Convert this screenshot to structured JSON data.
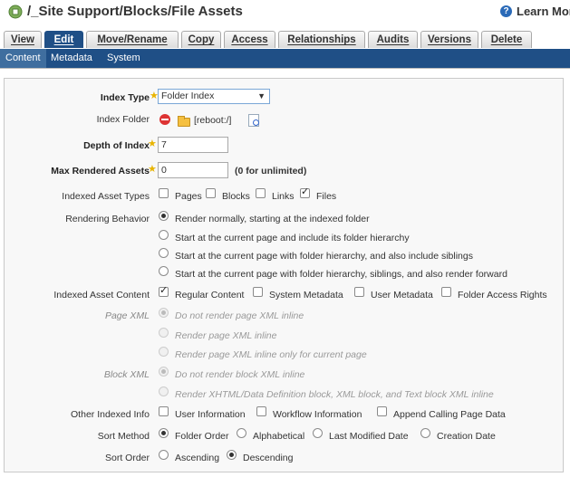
{
  "header": {
    "title": "/_Site Support/Blocks/File Assets",
    "learn_more": "Learn Mor",
    "help_icon": "?",
    "title_icon": "block-icon"
  },
  "tabs": [
    {
      "label": "View"
    },
    {
      "label": "Edit",
      "active": true
    },
    {
      "label": "Move/Rename"
    },
    {
      "label": "Copy"
    },
    {
      "label": "Access"
    },
    {
      "label": "Relationships"
    },
    {
      "label": "Audits"
    },
    {
      "label": "Versions"
    },
    {
      "label": "Delete"
    }
  ],
  "subtabs": [
    {
      "label": "Content",
      "active": true
    },
    {
      "label": "Metadata"
    },
    {
      "label": "System"
    }
  ],
  "form": {
    "index_type": {
      "label": "Index Type",
      "value": "Folder Index"
    },
    "index_folder": {
      "label": "Index Folder",
      "value": "[reboot:/]"
    },
    "depth_of_index": {
      "label": "Depth of Index",
      "value": "7"
    },
    "max_rendered_assets": {
      "label": "Max Rendered Assets",
      "value": "0",
      "hint": "(0 for unlimited)"
    },
    "indexed_asset_types": {
      "label": "Indexed Asset Types",
      "options": [
        {
          "label": "Pages",
          "checked": false
        },
        {
          "label": "Blocks",
          "checked": false
        },
        {
          "label": "Links",
          "checked": false
        },
        {
          "label": "Files",
          "checked": true
        }
      ]
    },
    "rendering_behavior": {
      "label": "Rendering Behavior",
      "options": [
        {
          "label": "Render normally, starting at the indexed folder",
          "checked": true
        },
        {
          "label": "Start at the current page and include its folder hierarchy",
          "checked": false
        },
        {
          "label": "Start at the current page with folder hierarchy, and also include siblings",
          "checked": false
        },
        {
          "label": "Start at the current page with folder hierarchy, siblings, and also render forward",
          "checked": false
        }
      ]
    },
    "indexed_asset_content": {
      "label": "Indexed Asset Content",
      "options": [
        {
          "label": "Regular Content",
          "checked": true
        },
        {
          "label": "System Metadata",
          "checked": false
        },
        {
          "label": "User Metadata",
          "checked": false
        },
        {
          "label": "Folder Access Rights",
          "checked": false
        }
      ]
    },
    "page_xml": {
      "label": "Page XML",
      "options": [
        {
          "label": "Do not render page XML inline",
          "checked": true
        },
        {
          "label": "Render page XML inline",
          "checked": false
        },
        {
          "label": "Render page XML inline only for current page",
          "checked": false
        }
      ]
    },
    "block_xml": {
      "label": "Block XML",
      "options": [
        {
          "label": "Do not render block XML inline",
          "checked": true
        },
        {
          "label": "Render XHTML/Data Definition block, XML block, and Text block XML inline",
          "checked": false
        }
      ]
    },
    "other_indexed_info": {
      "label": "Other Indexed Info",
      "options": [
        {
          "label": "User Information",
          "checked": false
        },
        {
          "label": "Workflow Information",
          "checked": false
        },
        {
          "label": "Append Calling Page Data",
          "checked": false
        }
      ]
    },
    "sort_method": {
      "label": "Sort Method",
      "options": [
        {
          "label": "Folder Order",
          "checked": true
        },
        {
          "label": "Alphabetical",
          "checked": false
        },
        {
          "label": "Last Modified Date",
          "checked": false
        },
        {
          "label": "Creation Date",
          "checked": false
        }
      ]
    },
    "sort_order": {
      "label": "Sort Order",
      "options": [
        {
          "label": "Ascending",
          "checked": false
        },
        {
          "label": "Descending",
          "checked": true
        }
      ]
    }
  },
  "colors": {
    "nav_blue": "#1f4f86",
    "required_star": "#e8b400"
  }
}
